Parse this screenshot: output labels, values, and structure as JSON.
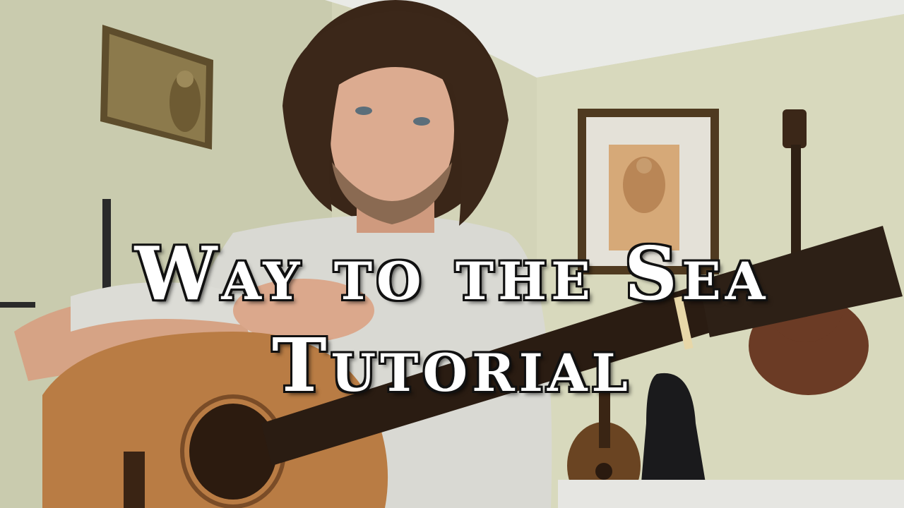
{
  "overlay": {
    "title_line_1": "Way to the Sea",
    "title_line_2": "Tutorial"
  },
  "colors": {
    "wall": "#cfd1b4",
    "ceiling": "#e8e9e4",
    "shirt": "#d9d9d4",
    "skin": "#d9a88d",
    "hair": "#3a2618",
    "guitar_body": "#b5793f",
    "guitar_neck": "#2a1c12",
    "frame": "#5a4226",
    "title_fill": "#ffffff",
    "title_outline": "#111111"
  },
  "icons": {
    "painting_left": "buddha-painting",
    "painting_right": "deity-framed-painting",
    "instrument_back_right": "hanging-guitar",
    "instrument_floor": "mandolin",
    "case_floor": "instrument-case"
  }
}
